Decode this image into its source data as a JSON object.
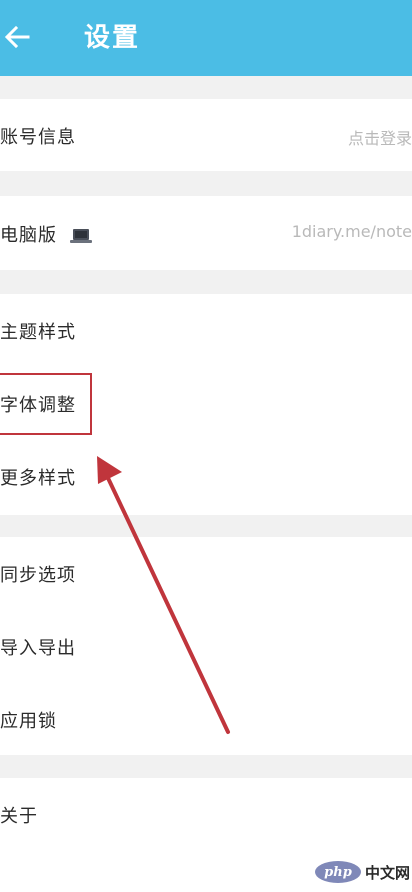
{
  "header": {
    "title": "设置",
    "background": "#4bbde5"
  },
  "account": {
    "label": "账号信息",
    "value": "点击登录"
  },
  "desktop": {
    "label": "电脑版",
    "icon": "laptop-icon",
    "value": "1diary.me/note"
  },
  "appearance": {
    "items": [
      {
        "label": "主题样式"
      },
      {
        "label": "字体调整"
      },
      {
        "label": "更多样式"
      }
    ]
  },
  "data_group": {
    "items": [
      {
        "label": "同步选项"
      },
      {
        "label": "导入导出"
      },
      {
        "label": "应用锁"
      }
    ]
  },
  "misc": {
    "items": [
      {
        "label": "关于"
      }
    ]
  },
  "annotation": {
    "color": "#c0353c"
  },
  "watermark": {
    "logo": "php",
    "text": "中文网"
  }
}
